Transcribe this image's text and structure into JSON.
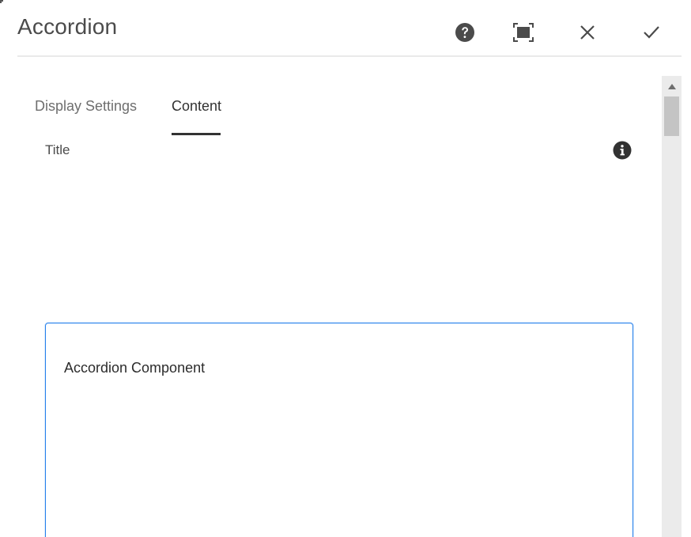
{
  "dialog": {
    "title": "Accordion",
    "actions": [
      {
        "name": "help-icon"
      },
      {
        "name": "fullscreen-icon"
      },
      {
        "name": "close-icon"
      },
      {
        "name": "done-check-icon"
      }
    ]
  },
  "tabs": [
    {
      "label": "Display Settings",
      "active": false
    },
    {
      "label": "Content",
      "active": true
    }
  ],
  "field": {
    "label": "Title",
    "info_icon": "info-icon",
    "value": "Accordion Component"
  },
  "colors": {
    "focus_border": "#2680eb",
    "scrollbar_track": "#ebebeb",
    "scrollbar_thumb": "#c4c4c4",
    "icon": "#4b4b4b"
  }
}
